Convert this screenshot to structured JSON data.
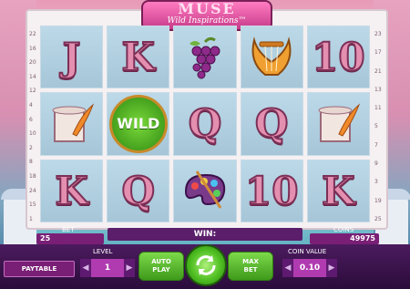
{
  "logo": {
    "title": "MUSE",
    "subtitle": "Wild Inspirations™"
  },
  "paylines_left": [
    "22",
    "16",
    "20",
    "14",
    "12",
    "4",
    "6",
    "10",
    "2",
    "8",
    "18",
    "24",
    "15",
    "1"
  ],
  "paylines_right": [
    "23",
    "17",
    "21",
    "13",
    "11",
    "5",
    "7",
    "9",
    "3",
    "19",
    "25"
  ],
  "reels": [
    [
      "J",
      "K",
      "grape-symbol",
      "lyre-symbol",
      "10"
    ],
    [
      "scroll-symbol",
      "WILD",
      "Q",
      "Q",
      "scroll-symbol"
    ],
    [
      "K",
      "Q",
      "palette-symbol",
      "10",
      "K"
    ]
  ],
  "hud": {
    "bet_label": "BET",
    "bet_value": "25",
    "win_label": "WIN:",
    "coins_label": "COINS",
    "coins_value": "49975",
    "paytable_label": "PAYTABLE",
    "level_label": "LEVEL",
    "level_value": "1",
    "autoplay_line1": "AUTO",
    "autoplay_line2": "PLAY",
    "maxbet_line1": "MAX",
    "maxbet_line2": "BET",
    "coin_value_label": "COIN VALUE",
    "coin_value": "0.10"
  },
  "icons": {
    "spin": "refresh-icon"
  }
}
